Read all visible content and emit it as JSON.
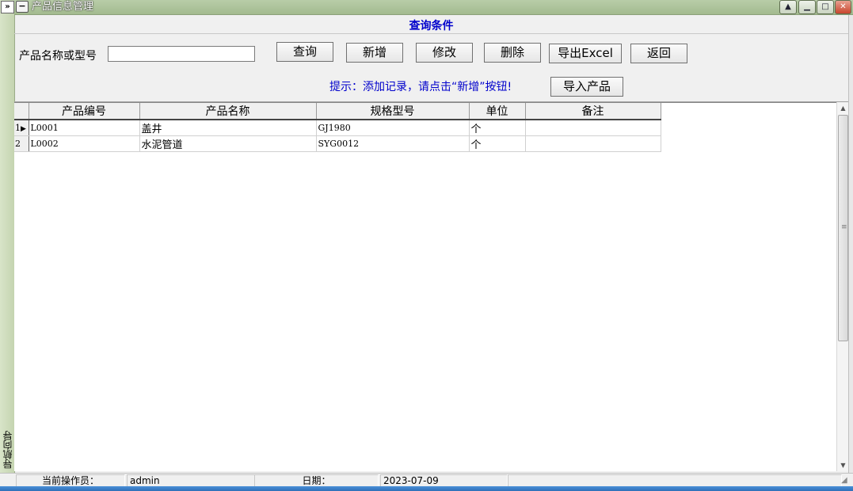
{
  "window": {
    "title": "产品信息管理"
  },
  "nav": {
    "toggle": "»",
    "label": "导航向导"
  },
  "query": {
    "section_title": "查询条件",
    "field_label": "产品名称或型号",
    "search_value": "",
    "buttons": {
      "search": "查询",
      "add": "新增",
      "edit": "修改",
      "delete": "删除",
      "export": "导出Excel",
      "back": "返回",
      "import": "导入产品"
    },
    "hint": "提示：添加记录，请点击“新增”按钮!"
  },
  "grid": {
    "columns": [
      "产品编号",
      "产品名称",
      "规格型号",
      "单位",
      "备注"
    ],
    "rows": [
      {
        "index": "1",
        "code": "L0001",
        "name": "盖井",
        "spec": "GJ1980",
        "unit": "个",
        "note": ""
      },
      {
        "index": "2",
        "code": "L0002",
        "name": "水泥管道",
        "spec": "SYG0012",
        "unit": "个",
        "note": ""
      }
    ],
    "current_row_marker": "▶"
  },
  "status": {
    "operator_label": "当前操作员：",
    "operator": "admin",
    "date_label": "日期：",
    "date": "2023-07-09"
  },
  "icons": {
    "minimize": "minimize-icon",
    "maximize": "maximize-icon",
    "close": "close-icon",
    "restore": "restore-up-icon"
  }
}
